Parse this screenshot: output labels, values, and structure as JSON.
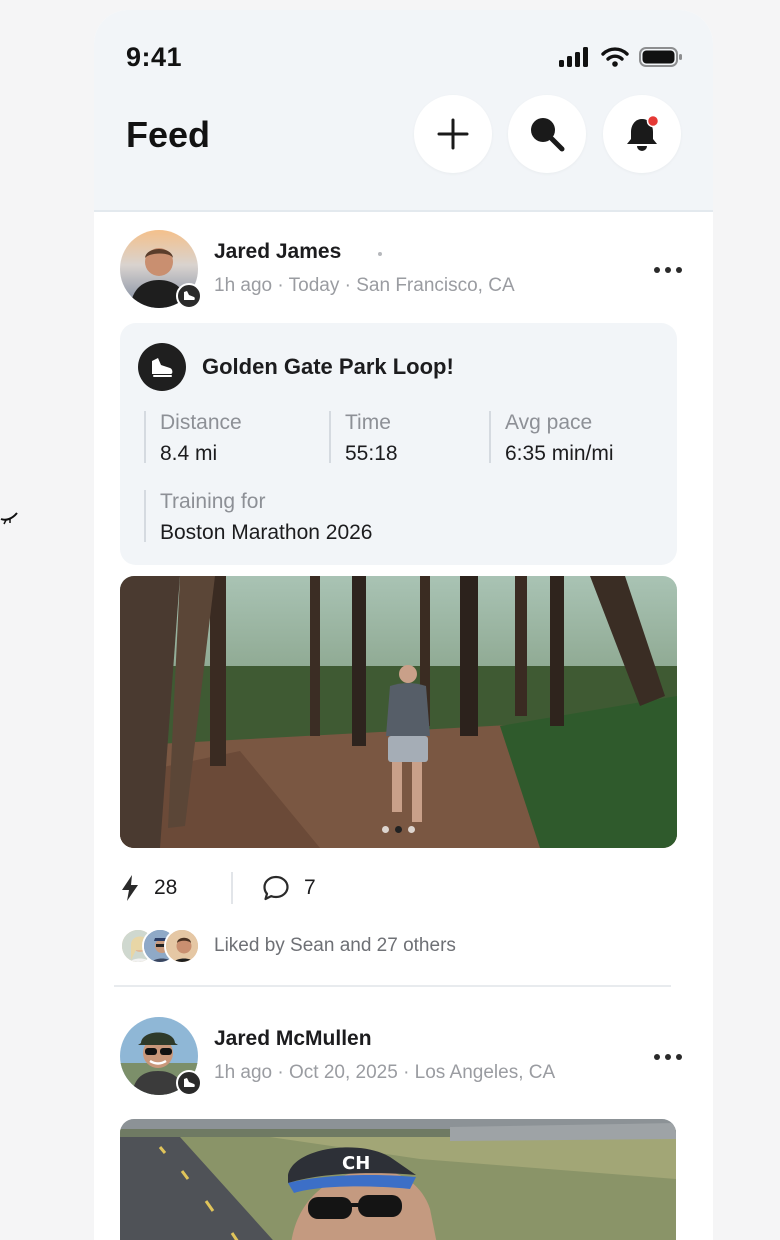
{
  "status_bar": {
    "time": "9:41"
  },
  "header": {
    "title": "Feed",
    "add_icon": "plus-icon",
    "search_icon": "search-icon",
    "notifications_icon": "bell-icon",
    "notification_dot_color": "#e53935"
  },
  "posts": [
    {
      "author": "Jared James",
      "meta": "1h ago · Today · San Francisco, CA",
      "activity": {
        "title": "Golden Gate Park Loop!",
        "stats": [
          {
            "label": "Distance",
            "value": "8.4 mi"
          },
          {
            "label": "Time",
            "value": "55:18"
          },
          {
            "label": "Avg pace",
            "value": "6:35 min/mi"
          }
        ],
        "training_label": "Training for",
        "training_value": "Boston Marathon 2026"
      },
      "photo_pages": 3,
      "photo_active_page": 2,
      "kudos": "28",
      "comments": "7",
      "liked_by": "Liked by Sean and 27 others"
    },
    {
      "author": "Jared McMullen",
      "meta": "1h ago · Oct 20, 2025 · Los Angeles, CA"
    }
  ],
  "colors": {
    "header_bg": "#f2f5f8",
    "card_bg": "#f2f5f8",
    "text_primary": "#1c1c1e",
    "text_muted": "#9a9ca1"
  }
}
